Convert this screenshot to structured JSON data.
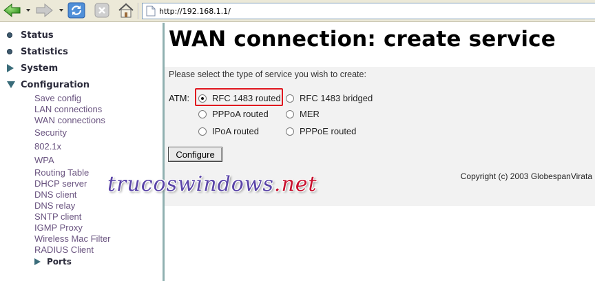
{
  "browser": {
    "address": "http://192.168.1.1/"
  },
  "sidebar": {
    "top_items": [
      {
        "label": "Status",
        "bullet": "dot"
      },
      {
        "label": "Statistics",
        "bullet": "dot"
      },
      {
        "label": "System",
        "bullet": "triangle-right"
      },
      {
        "label": "Configuration",
        "bullet": "triangle-down"
      }
    ],
    "sub_items": [
      "Save config",
      "LAN connections",
      "WAN connections",
      "Security",
      "802.1x",
      "WPA",
      "Routing Table",
      "DHCP server",
      "DNS client",
      "DNS relay",
      "SNTP client",
      "IGMP Proxy",
      "Wireless Mac Filter",
      "RADIUS Client"
    ],
    "ports_label": "Ports"
  },
  "main": {
    "title": "WAN connection: create service",
    "instruction": "Please select the type of service you wish to create:",
    "atm_label": "ATM:",
    "options": [
      {
        "label": "RFC 1483 routed",
        "checked": true
      },
      {
        "label": "RFC 1483 bridged",
        "checked": false
      },
      {
        "label": "PPPoA routed",
        "checked": false
      },
      {
        "label": "MER",
        "checked": false
      },
      {
        "label": "IPoA routed",
        "checked": false
      },
      {
        "label": "PPPoE routed",
        "checked": false
      }
    ],
    "configure_label": "Configure",
    "copyright": "Copyright (c) 2003 GlobespanVirata"
  },
  "watermark": {
    "main": "trucoswindows",
    "suffix": ".net"
  },
  "colors": {
    "highlight": "#e0161e",
    "nav_text": "#2b2b3b",
    "sub_nav_text": "#6a5480",
    "sidebar_border": "#8fb0b0",
    "watermark": "#5a44a8"
  },
  "icons": [
    "back-arrow-icon",
    "forward-arrow-icon",
    "refresh-icon",
    "stop-icon",
    "home-icon",
    "page-icon"
  ]
}
